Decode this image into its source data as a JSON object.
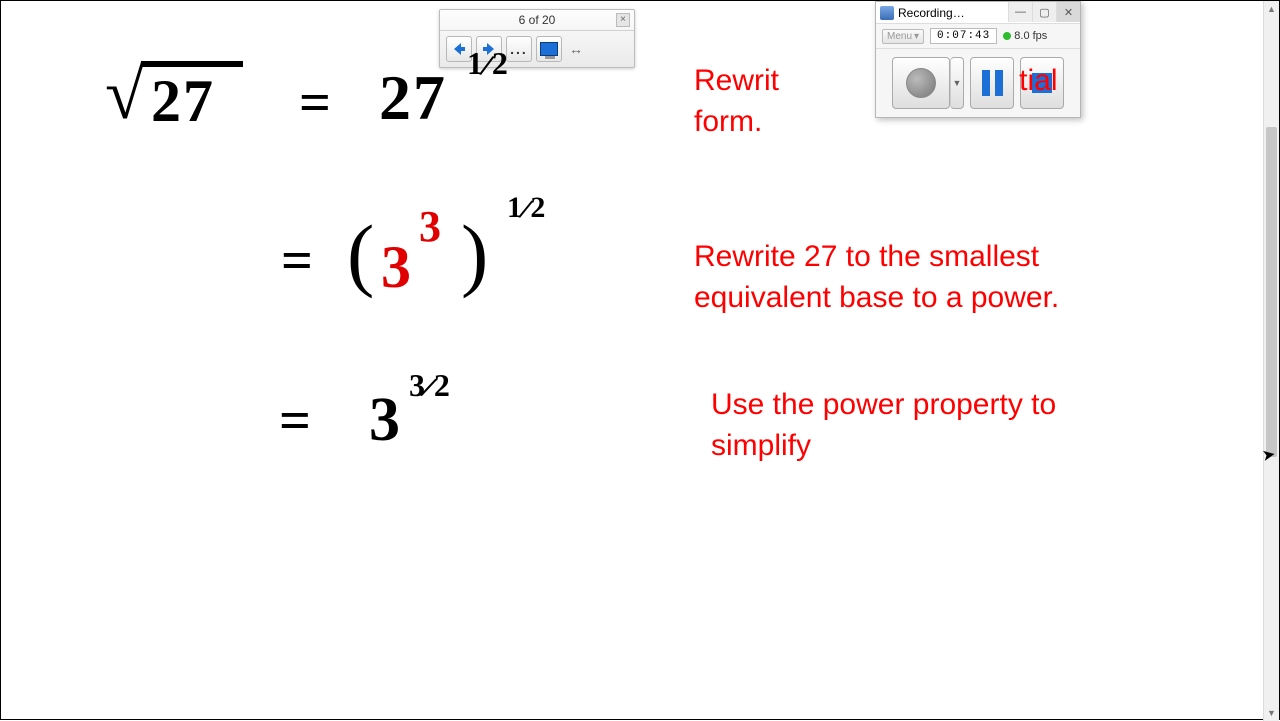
{
  "pager": {
    "label": "6 of 20",
    "close": "×",
    "dots": "...",
    "swap": "↔"
  },
  "recorder": {
    "title": "Recording…",
    "menu": "Menu",
    "time": "0:07:43",
    "fps": "8.0 fps",
    "min": "—",
    "max": "▢",
    "close": "✕"
  },
  "text": {
    "line1a": "Rewrit",
    "line1b": "tial form.",
    "line2": "Rewrite 27 to the smallest equivalent base to a power.",
    "line3": "Use the power property to simplify"
  },
  "math": {
    "sqrt": "√",
    "n27": "27",
    "eq": "=",
    "lpar": "(",
    "rpar": ")",
    "three": "3",
    "half_num": "1",
    "half_den": "2",
    "tf_num": "3",
    "tf_den": "2"
  }
}
